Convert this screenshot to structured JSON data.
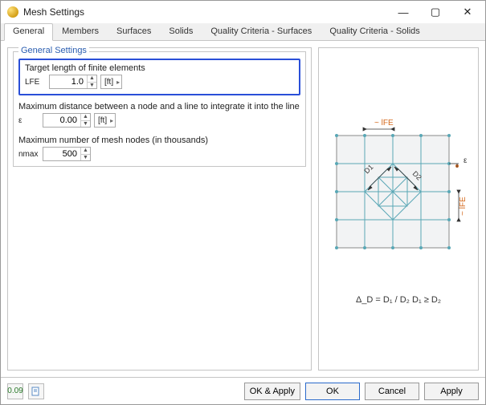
{
  "window": {
    "title": "Mesh Settings"
  },
  "tabs": {
    "t0": "General",
    "t1": "Members",
    "t2": "Surfaces",
    "t3": "Solids",
    "t4": "Quality Criteria - Surfaces",
    "t5": "Quality Criteria - Solids"
  },
  "group": {
    "title": "General Settings"
  },
  "target": {
    "label": "Target length of finite elements",
    "sym": "LFE",
    "value": "1.0",
    "unit": "[ft]"
  },
  "maxdist": {
    "label": "Maximum distance between a node and a line to integrate it into the line",
    "sym": "ε",
    "value": "0.00",
    "unit": "[ft]"
  },
  "maxnodes": {
    "label": "Maximum number of mesh nodes (in thousands)",
    "sym": "nmax",
    "value": "500"
  },
  "diagram": {
    "lfe_top": "~ lFE",
    "lfe_side": "~ lFE",
    "eps": "ε",
    "d1": "D1",
    "d2": "D2",
    "formula": "Δ_D  =  D₁ / D₂      D₁ ≥ D₂"
  },
  "buttons": {
    "okapply": "OK & Apply",
    "ok": "OK",
    "cancel": "Cancel",
    "apply": "Apply"
  },
  "statusicons": {
    "units": "0.09"
  }
}
